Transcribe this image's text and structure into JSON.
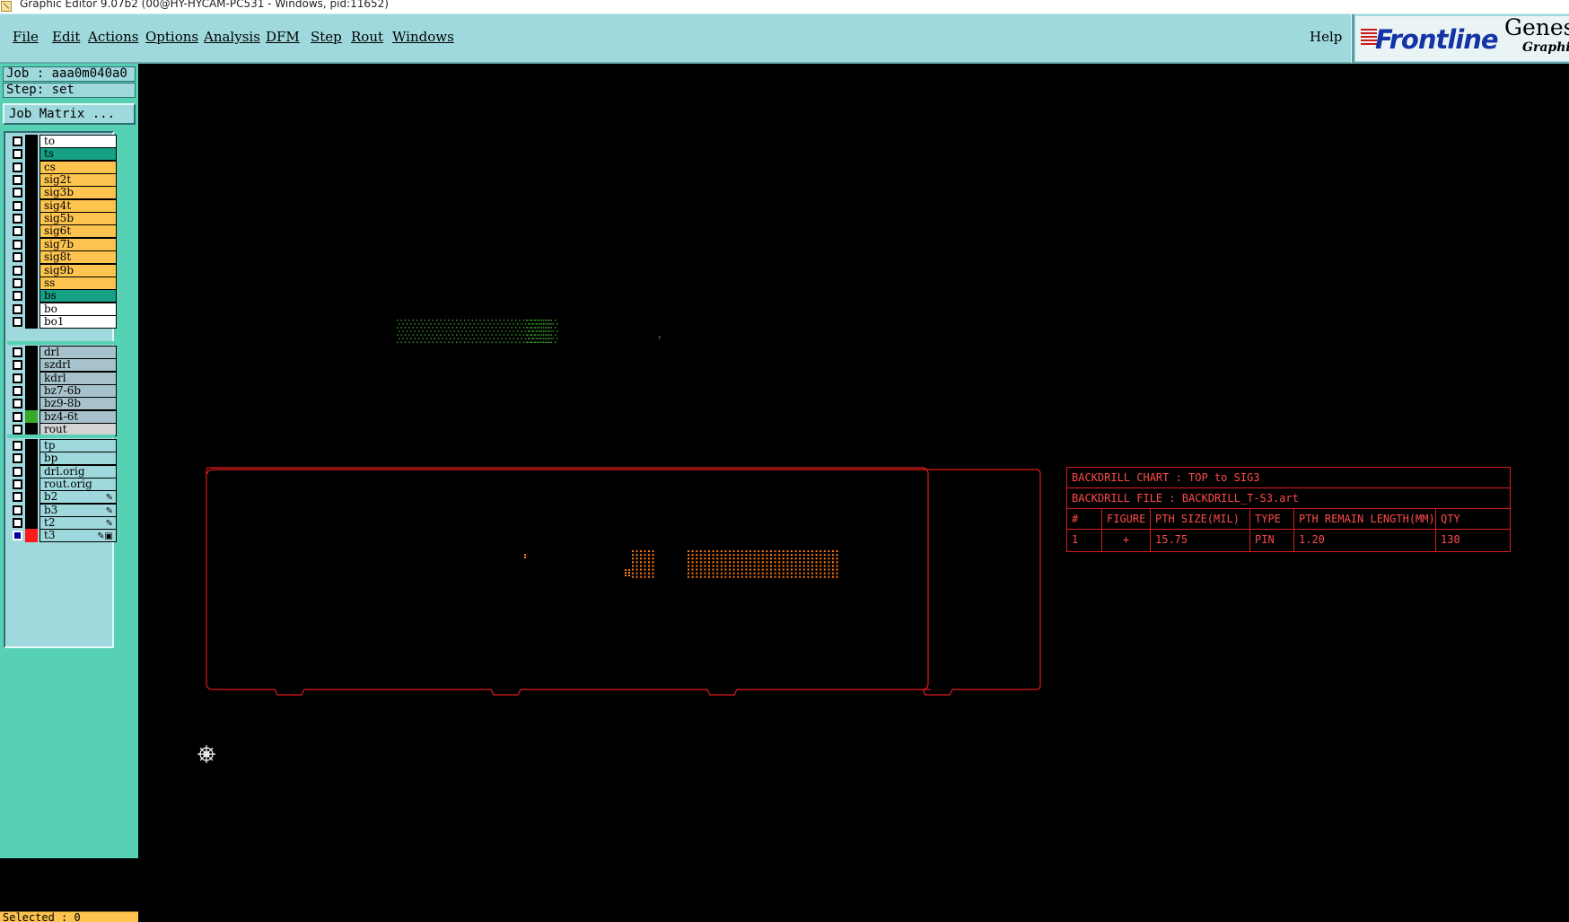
{
  "window": {
    "title": "Graphic Editor 9.07b2 (00@HY-HYCAM-PC531 - Windows, pid:11652)"
  },
  "menubar": {
    "items": [
      {
        "label": "File"
      },
      {
        "label": "Edit"
      },
      {
        "label": "Actions"
      },
      {
        "label": "Options"
      },
      {
        "label": "Analysis"
      },
      {
        "label": "DFM"
      },
      {
        "label": "Step"
      },
      {
        "label": "Rout"
      },
      {
        "label": "Windows"
      }
    ],
    "help": "Help"
  },
  "logo": {
    "brand": "Frontline",
    "product": "Genesis",
    "product_sub": "Graphic"
  },
  "left_panel": {
    "job": "Job : aaa0m040a0",
    "step": "Step: set",
    "job_matrix": "Job Matrix ...",
    "selected": "Selected : 0"
  },
  "layers": {
    "board": [
      {
        "name": "to",
        "color": "#ffffff"
      },
      {
        "name": "ts",
        "color": "#16a085"
      },
      {
        "name": "cs",
        "color": "#fdc44f"
      },
      {
        "name": "sig2t",
        "color": "#fdc44f"
      },
      {
        "name": "sig3b",
        "color": "#fdc44f"
      },
      {
        "name": "sig4t",
        "color": "#fdc44f"
      },
      {
        "name": "sig5b",
        "color": "#fdc44f"
      },
      {
        "name": "sig6t",
        "color": "#fdc44f"
      },
      {
        "name": "sig7b",
        "color": "#fdc44f"
      },
      {
        "name": "sig8t",
        "color": "#fdc44f"
      },
      {
        "name": "sig9b",
        "color": "#fdc44f"
      },
      {
        "name": "ss",
        "color": "#fdc44f"
      },
      {
        "name": "bs",
        "color": "#16a085"
      },
      {
        "name": "bo",
        "color": "#ffffff"
      },
      {
        "name": "bo1",
        "color": "#ffffff"
      }
    ],
    "drill": [
      {
        "name": "drl",
        "color": "#a7c2cc"
      },
      {
        "name": "szdrl",
        "color": "#a7c2cc"
      },
      {
        "name": "kdrl",
        "color": "#a7c2cc"
      },
      {
        "name": "bz7-6b",
        "color": "#a7c2cc"
      },
      {
        "name": "bz9-8b",
        "color": "#a7c2cc"
      },
      {
        "name": "bz4-6t",
        "color": "#a7c2cc",
        "swatch": "#3aa82a"
      },
      {
        "name": "rout",
        "color": "#d4d4d4"
      }
    ],
    "misc": [
      {
        "name": "tp",
        "color": "#9fd9dd"
      },
      {
        "name": "bp",
        "color": "#9fd9dd"
      },
      {
        "name": "drl.orig",
        "color": "#9fd9dd"
      },
      {
        "name": "rout.orig",
        "color": "#9fd9dd"
      },
      {
        "name": "b2",
        "color": "#9fd9dd",
        "icon": "✎"
      },
      {
        "name": "b3",
        "color": "#9fd9dd",
        "icon": "✎"
      },
      {
        "name": "t2",
        "color": "#9fd9dd",
        "icon": "✎"
      },
      {
        "name": "t3",
        "color": "#9fd9dd",
        "icon": "✎▣",
        "active": true,
        "swatch": "#ff1a1a"
      }
    ]
  },
  "backdrill_chart": {
    "title": "BACKDRILL CHART : TOP to SIG3",
    "file": "BACKDRILL FILE : BACKDRILL_T-S3.art",
    "headers": [
      "#",
      "FIGURE",
      "PTH SIZE(MIL)",
      "TYPE",
      "PTH REMAIN LENGTH(MM)",
      "QTY"
    ],
    "rows": [
      [
        "1",
        "+",
        "15.75",
        "PIN",
        "1.20",
        "130"
      ]
    ]
  },
  "colors": {
    "outline": "#e01a1a",
    "drill_top": "#3aa82a",
    "drill_pads": "#ff7a10"
  }
}
